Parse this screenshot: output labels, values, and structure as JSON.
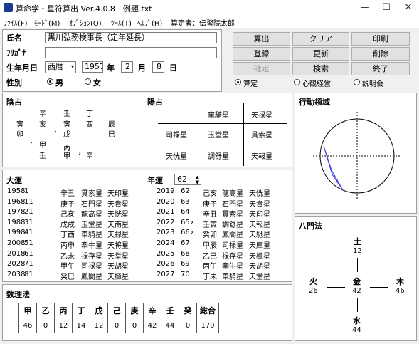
{
  "window": {
    "title": "算命学・星符算出 Ver.4.0.8　例題.txt",
    "min": "—",
    "max": "☐",
    "close": "✕"
  },
  "menu": [
    "ﾌｧｲﾙ(F)",
    "ﾓｰﾄﾞ(M)",
    "ｵﾌﾟｼｮﾝ(O)",
    "ﾂｰﾙ(T)",
    "ﾍﾙﾌﾟ(H)",
    "算定者：伝習院太郎"
  ],
  "form": {
    "name_label": "氏名",
    "name_value": "黒川弘務検事長（定年延長）",
    "kana_label": "ﾌﾘｶﾞﾅ",
    "kana_value": "",
    "dob_label": "生年月日",
    "era": "西暦",
    "year": "1957",
    "year_unit": "年",
    "month": "2",
    "month_unit": "月",
    "day": "8",
    "day_unit": "日",
    "sex_label": "性別",
    "sex_male": "男",
    "sex_female": "女"
  },
  "buttons": [
    "算出",
    "クリア",
    "印刷",
    "登録",
    "更新",
    "削除",
    "確定",
    "検索",
    "終了"
  ],
  "mode_radios": [
    "算定",
    "心観経営",
    "説明会"
  ],
  "inzen": {
    "title": "陰占",
    "row1": [
      "辛",
      "壬",
      "丁"
    ],
    "row2": [
      "寅",
      "亥",
      "寅",
      "酉",
      "辰"
    ],
    "row3": [
      "卯",
      "戊",
      "巳"
    ],
    "row4": [
      "甲"
    ],
    "row5": [
      "丙"
    ],
    "row6": [
      "壬",
      "甲",
      "辛"
    ]
  },
  "yosen": {
    "title": "陽占",
    "cells": [
      "車騎星",
      "天禄星",
      "司禄星",
      "玉堂星",
      "貫索星",
      "天恍星",
      "調舒星",
      "天報星"
    ]
  },
  "kodo": {
    "title": "行動領域"
  },
  "taiun": {
    "title": "大運",
    "left": [
      [
        "1958",
        "1",
        "辛丑",
        "貫索星",
        "天印星"
      ],
      [
        "1968",
        "11",
        "庚子",
        "石門星",
        "天貴星"
      ],
      [
        "1978",
        "21",
        "己亥",
        "龍高星",
        "天恍星"
      ],
      [
        "1988",
        "31",
        "戊戌",
        "玉堂星",
        "天南星"
      ],
      [
        "1998",
        "41",
        "丁酉",
        "車騎星",
        "天禄星"
      ],
      [
        "2008",
        "51",
        "丙申",
        "牽牛星",
        "天将星"
      ],
      [
        "2018",
        "61",
        "乙未",
        "禄存星",
        "天堂星"
      ],
      [
        "2028",
        "71",
        "甲午",
        "司禄星",
        "天胡星"
      ],
      [
        "2038",
        "81",
        "癸巳",
        "鳳閣星",
        "天極星"
      ]
    ]
  },
  "nenun": {
    "title": "年運",
    "age": "62",
    "rows": [
      [
        "2019",
        "62",
        "",
        "己亥",
        "龍高星",
        "天恍星"
      ],
      [
        "2020",
        "63",
        "",
        "庚子",
        "石門星",
        "天貴星"
      ],
      [
        "2021",
        "64",
        "",
        "辛丑",
        "貫索星",
        "天印星"
      ],
      [
        "2022",
        "65",
        "›",
        "壬寅",
        "調舒星",
        "天報星"
      ],
      [
        "2023",
        "66",
        "›",
        "癸卯",
        "鳳閣星",
        "天馳星"
      ],
      [
        "2024",
        "67",
        "",
        "甲辰",
        "司禄星",
        "天庫星"
      ],
      [
        "2025",
        "68",
        "",
        "乙巳",
        "禄存星",
        "天極星"
      ],
      [
        "2026",
        "69",
        "",
        "丙午",
        "牽牛星",
        "天胡星"
      ],
      [
        "2027",
        "70",
        "",
        "丁未",
        "車騎星",
        "天堂星"
      ]
    ]
  },
  "suri": {
    "title": "数理法",
    "headers": [
      "甲",
      "乙",
      "丙",
      "丁",
      "戊",
      "己",
      "庚",
      "辛",
      "壬",
      "癸",
      "総合"
    ],
    "values": [
      "46",
      "0",
      "12",
      "14",
      "12",
      "0",
      "0",
      "42",
      "44",
      "0",
      "170"
    ]
  },
  "happo": {
    "title": "八門法",
    "earth": "土",
    "earth_v": "12",
    "fire": "火",
    "fire_v": "26",
    "metal": "金",
    "metal_v": "42",
    "wood": "木",
    "wood_v": "46",
    "water": "水",
    "water_v": "44"
  }
}
